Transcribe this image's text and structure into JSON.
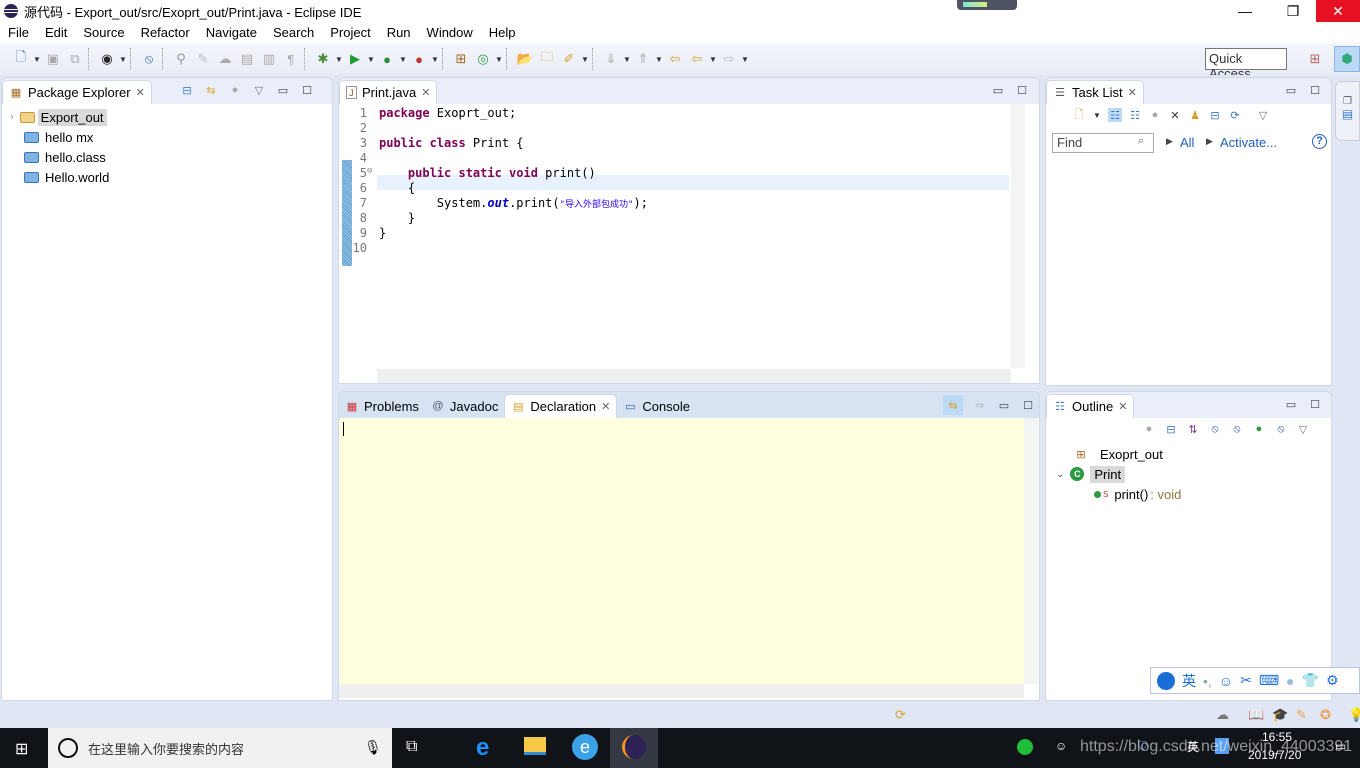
{
  "window": {
    "title": "源代码 - Export_out/src/Exoprt_out/Print.java - Eclipse IDE",
    "minimize": "—",
    "maximize": "❐",
    "close": "✕"
  },
  "menu": [
    "File",
    "Edit",
    "Source",
    "Refactor",
    "Navigate",
    "Search",
    "Project",
    "Run",
    "Window",
    "Help"
  ],
  "toolbar": {
    "quick_access": "Quick Access"
  },
  "package_explorer": {
    "title": "Package Explorer",
    "items": [
      {
        "label": "Export_out",
        "type": "project",
        "selected": true
      },
      {
        "label": "hello mx",
        "type": "folder"
      },
      {
        "label": "hello.class",
        "type": "folder"
      },
      {
        "label": "Hello.world",
        "type": "folder"
      }
    ]
  },
  "editor": {
    "tab": "Print.java",
    "lines": [
      {
        "n": "1",
        "code": "package Exoprt_out;"
      },
      {
        "n": "2",
        "code": ""
      },
      {
        "n": "3",
        "code": "public class Print {"
      },
      {
        "n": "4",
        "code": ""
      },
      {
        "n": "5",
        "code": "    public static void print()"
      },
      {
        "n": "6",
        "code": "    {"
      },
      {
        "n": "7",
        "code": "        System.out.print(\"导入外部包成功\");"
      },
      {
        "n": "8",
        "code": "    }"
      },
      {
        "n": "9",
        "code": "}"
      },
      {
        "n": "10",
        "code": ""
      }
    ],
    "string_literal": "\"导入外部包成功\""
  },
  "task_list": {
    "title": "Task List",
    "find_placeholder": "Find",
    "all": "All",
    "activate": "Activate..."
  },
  "bottom": {
    "tabs": [
      "Problems",
      "Javadoc",
      "Declaration",
      "Console"
    ],
    "active": "Declaration"
  },
  "outline": {
    "title": "Outline",
    "package": "Exoprt_out",
    "class": "Print",
    "method": "print()",
    "method_type": " : void",
    "static_marker": "S"
  },
  "taskbar": {
    "search_placeholder": "在这里输入你要搜索的内容",
    "time": "16:55",
    "date": "2019/7/20",
    "ime_lang": "英",
    "watermark": "https://blog.csdn.net/weixin_44003391"
  },
  "ime_toolbar": {
    "lang": "英"
  }
}
